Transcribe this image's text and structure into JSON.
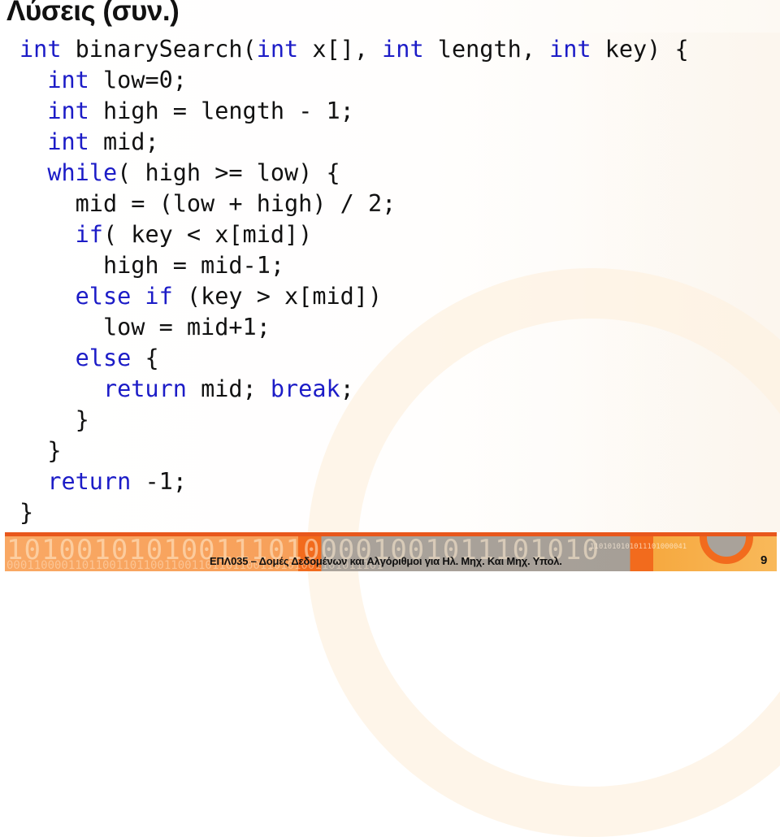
{
  "slide": {
    "title": "Λύσεις (συν.)",
    "code_lines": [
      [
        {
          "t": "int",
          "kw": true
        },
        {
          "t": " binarySearch("
        },
        {
          "t": "int",
          "kw": true
        },
        {
          "t": " x[], "
        },
        {
          "t": "int",
          "kw": true
        },
        {
          "t": " length, "
        },
        {
          "t": "int",
          "kw": true
        },
        {
          "t": " key) {"
        }
      ],
      [
        {
          "t": "  "
        },
        {
          "t": "int",
          "kw": true
        },
        {
          "t": " low=0;"
        }
      ],
      [
        {
          "t": "  "
        },
        {
          "t": "int",
          "kw": true
        },
        {
          "t": " high = length - 1;"
        }
      ],
      [
        {
          "t": "  "
        },
        {
          "t": "int",
          "kw": true
        },
        {
          "t": " mid;"
        }
      ],
      [
        {
          "t": "  "
        },
        {
          "t": "while",
          "kw": true
        },
        {
          "t": "( high >= low) {"
        }
      ],
      [
        {
          "t": "    mid = (low + high) / 2;"
        }
      ],
      [
        {
          "t": "    "
        },
        {
          "t": "if",
          "kw": true
        },
        {
          "t": "( key < x[mid])"
        }
      ],
      [
        {
          "t": "      high = mid-1;"
        }
      ],
      [
        {
          "t": "    "
        },
        {
          "t": "else if",
          "kw": true
        },
        {
          "t": " (key > x[mid])"
        }
      ],
      [
        {
          "t": "      low = mid+1;"
        }
      ],
      [
        {
          "t": "    "
        },
        {
          "t": "else",
          "kw": true
        },
        {
          "t": " {"
        }
      ],
      [
        {
          "t": "      "
        },
        {
          "t": "return",
          "kw": true
        },
        {
          "t": " mid; "
        },
        {
          "t": "break",
          "kw": true
        },
        {
          "t": ";"
        }
      ],
      [
        {
          "t": "    }"
        }
      ],
      [
        {
          "t": "  }"
        }
      ],
      [
        {
          "t": "  "
        },
        {
          "t": "return",
          "kw": true
        },
        {
          "t": " -1;"
        }
      ],
      [
        {
          "t": "}"
        }
      ]
    ]
  },
  "footer": {
    "course_text": "ΕΠΛ035 – Δομές Δεδομένων και Αλγόριθμοι για Ηλ. Μηχ. Και Μηχ. Υπολ.",
    "page_number": "9",
    "binary_big": "1010010101001110100001001011101010",
    "binary_small": "0001100001101100110110011001101101100110101001101011101",
    "binary_right": "1101010101011101000041"
  },
  "colors": {
    "keyword": "#1c1cc7",
    "text": "#111111",
    "accent_orange": "#f26b1d",
    "band_orange": "#f9a864",
    "band_gray": "#a69f97",
    "band_yellow": "#f9b95a"
  }
}
